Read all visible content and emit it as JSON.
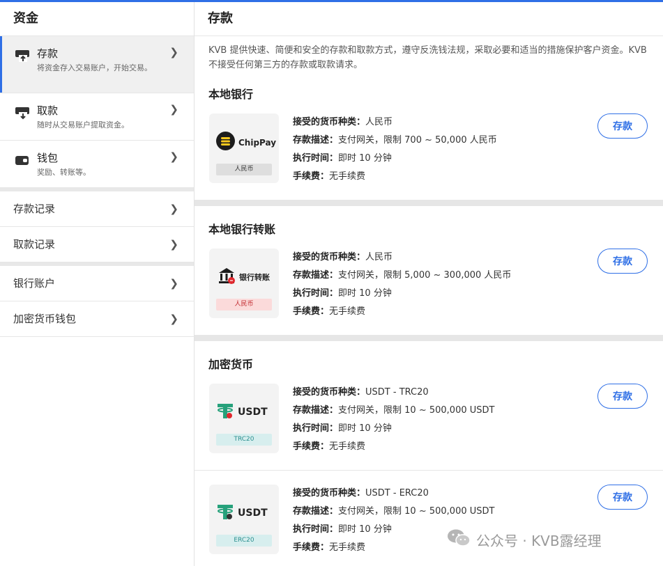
{
  "sidebar": {
    "title": "资金",
    "nav": [
      {
        "title": "存款",
        "desc": "将资金存入交易账户，开始交易。"
      },
      {
        "title": "取款",
        "desc": "随时从交易账户提取资金。"
      },
      {
        "title": "钱包",
        "desc": "奖励、转账等。"
      }
    ],
    "records": [
      "存款记录",
      "取款记录"
    ],
    "accounts": [
      "银行账户",
      "加密货币钱包"
    ]
  },
  "main": {
    "title": "存款",
    "intro": "KVB 提供快速、简便和安全的存款和取款方式，遵守反洗钱法规，采取必要和适当的措施保护客户资金。KVB 不接受任何第三方的存款或取款请求。",
    "labels": {
      "currency": "接受的货币种类：",
      "desc": "存款描述：",
      "time": "执行时间：",
      "fee": "手续费："
    },
    "button_label": "存款",
    "sections": [
      {
        "title": "本地银行",
        "methods": [
          {
            "logo": "ChipPay",
            "tag": "人民币",
            "currency": "人民币",
            "desc": "支付网关，限制 700 ~ 50,000 人民币",
            "time": "即时 10 分钟",
            "fee": "无手续费"
          }
        ]
      },
      {
        "title": "本地银行转账",
        "methods": [
          {
            "logo": "银行转账",
            "tag": "人民币",
            "currency": "人民币",
            "desc": "支付网关，限制 5,000 ~ 300,000 人民币",
            "time": "即时 10 分钟",
            "fee": "无手续费"
          }
        ]
      },
      {
        "title": "加密货币",
        "methods": [
          {
            "logo": "USDT",
            "tag": "TRC20",
            "currency": "USDT - TRC20",
            "desc": "支付网关，限制 10 ~ 500,000 USDT",
            "time": "即时 10 分钟",
            "fee": "无手续费"
          },
          {
            "logo": "USDT",
            "tag": "ERC20",
            "currency": "USDT - ERC20",
            "desc": "支付网关，限制 10 ~ 500,000 USDT",
            "time": "即时 10 分钟",
            "fee": "无手续费"
          }
        ]
      }
    ]
  },
  "watermark": "公众号 · KVB露经理",
  "colors": {
    "accent": "#2f6fe6",
    "tag_gray": "#dedede",
    "tag_red": "#fbdada",
    "tag_teal": "#d7eeee",
    "tether": "#26a17b"
  }
}
